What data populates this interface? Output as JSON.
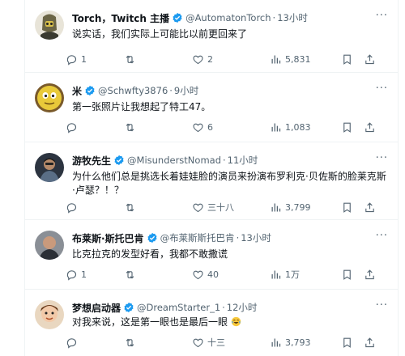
{
  "colors": {
    "verified": "#1d9bf0",
    "muted": "#536471",
    "text": "#0f1419",
    "divider": "#eff3f4"
  },
  "icons": {
    "reply": "reply-icon",
    "retweet": "retweet-icon",
    "like": "heart-icon",
    "views": "views-icon",
    "bookmark": "bookmark-icon",
    "share": "share-icon",
    "verified": "verified-badge-icon",
    "more": "more-icon"
  },
  "more_glyph": "···",
  "separator": "·",
  "tweets": [
    {
      "name": "Torch，Twitch 主播",
      "handle": "@AutomatonTorch",
      "time": "13小时",
      "text": "说实话，我们实际上可能比以前更回来了",
      "reply_count": "1",
      "retweet_count": "",
      "like_count": "2",
      "view_count": "5,831"
    },
    {
      "name": "米",
      "handle": "@Schwfty3876",
      "time": "9小时",
      "text": "第一张照片让我想起了特工47。",
      "reply_count": "",
      "retweet_count": "",
      "like_count": "6",
      "view_count": "1,083"
    },
    {
      "name": "游牧先生",
      "handle": "@MisunderstNomad",
      "time": "11小时",
      "text": "为什么他们总是挑选长着娃娃脸的演员来扮演布罗利克·贝佐斯的脸莱克斯·卢瑟？！？",
      "reply_count": "",
      "retweet_count": "",
      "like_count": "三十八",
      "view_count": "3,799"
    },
    {
      "name": "布莱斯·斯托巴肯",
      "handle": "@布莱斯斯托巴肯",
      "time": "13小时",
      "text": "比克拉克的发型好看，我都不敢撒谎",
      "reply_count": "1",
      "retweet_count": "",
      "like_count": "40",
      "view_count": "1万"
    },
    {
      "name": "梦想启动器",
      "handle": "@DreamStarter_1",
      "time": "12小时",
      "text": "对我来说，这是第一眼也是最后一眼",
      "reply_count": "",
      "retweet_count": "",
      "like_count": "十三",
      "view_count": "3,793"
    }
  ]
}
